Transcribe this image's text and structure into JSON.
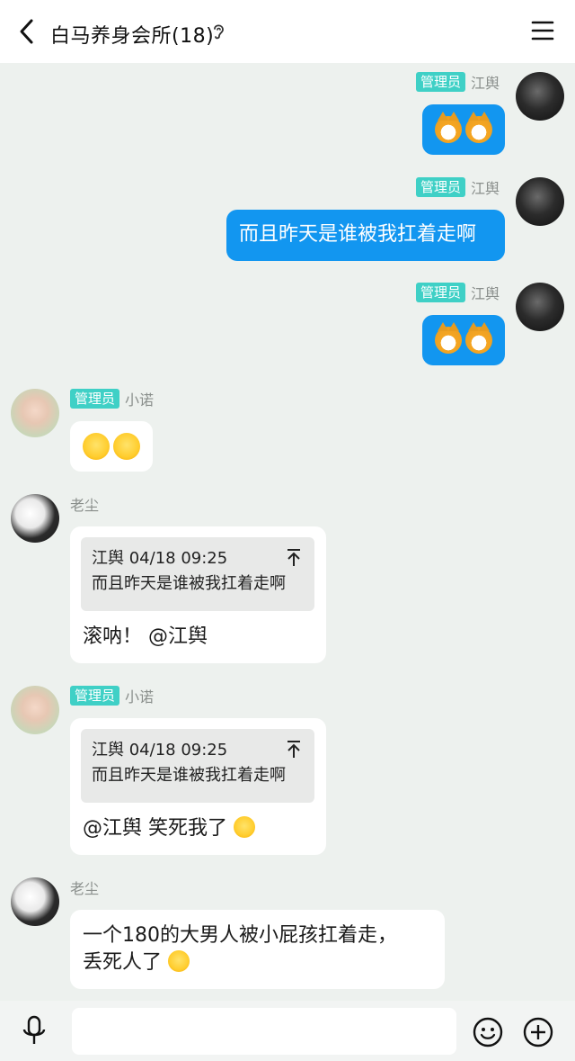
{
  "header": {
    "title": "白马养身会所(18)"
  },
  "messages": [
    {
      "side": "right",
      "badge": "管理员",
      "nick": "江舆",
      "type": "emoji"
    },
    {
      "side": "right",
      "badge": "管理员",
      "nick": "江舆",
      "text": "而且昨天是谁被我扛着走啊"
    },
    {
      "side": "right",
      "badge": "管理员",
      "nick": "江舆",
      "type": "emoji"
    },
    {
      "side": "left",
      "badge": "管理员",
      "nick": "小诺",
      "type": "emoji"
    },
    {
      "side": "left",
      "nick": "老尘",
      "quote_header": "江舆 04/18 09:25",
      "quote_text": "而且昨天是谁被我扛着走啊",
      "text": "滚呐！ @江舆"
    },
    {
      "side": "left",
      "badge": "管理员",
      "nick": "小诺",
      "quote_header": "江舆 04/18 09:25",
      "quote_text": "而且昨天是谁被我扛着走啊",
      "text": "@江舆 笑死我了"
    },
    {
      "side": "left",
      "nick": "老尘",
      "line1": "一个180的大男人被小屁孩扛着走，",
      "line2": "丢死人了"
    }
  ],
  "colors": {
    "accent": "#1296f0",
    "badge": "#3fd0c6",
    "background": "#edf1ee"
  },
  "icons": [
    "back-icon",
    "ear-icon",
    "menu-icon",
    "mic-icon",
    "smile-icon",
    "plus-icon",
    "pin-top-icon"
  ]
}
